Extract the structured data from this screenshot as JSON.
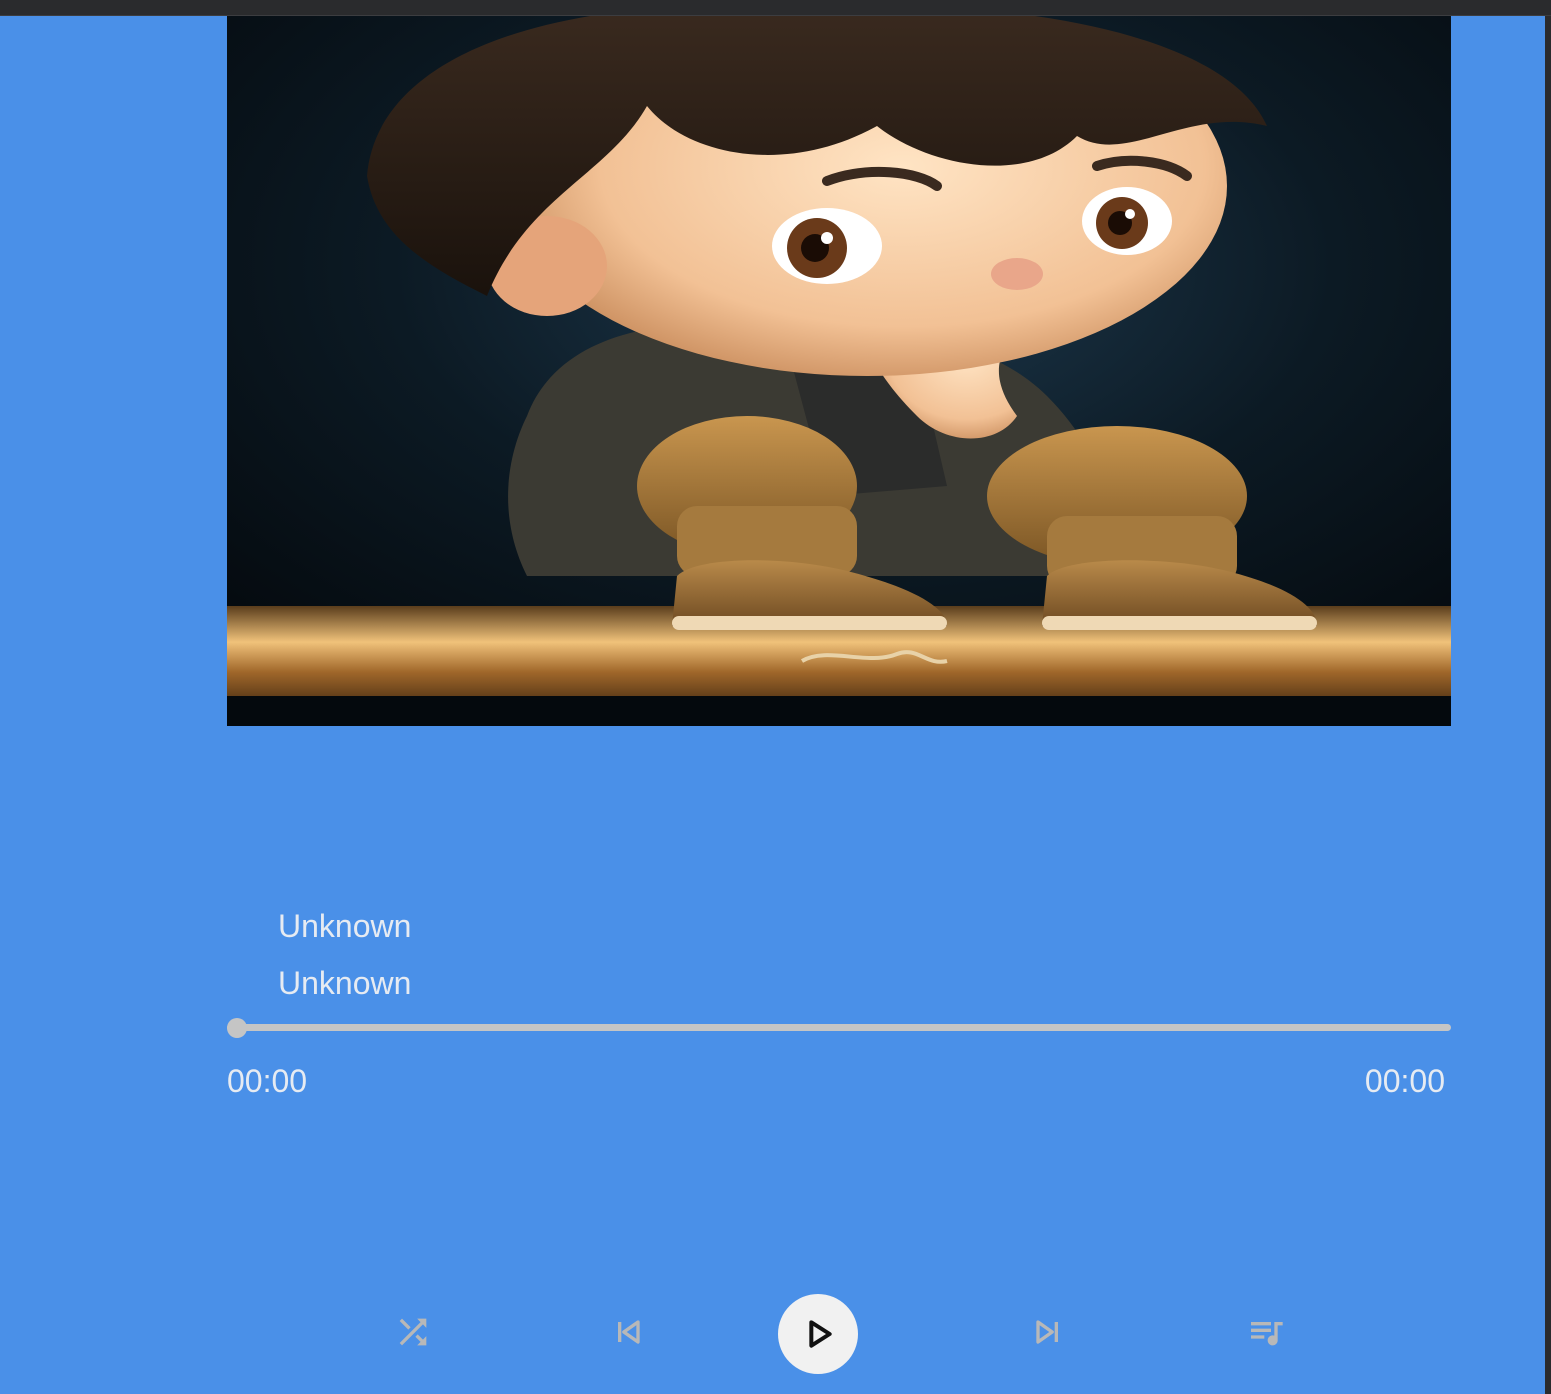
{
  "player": {
    "track": {
      "title": "Unknown",
      "artist": "Unknown"
    },
    "progress": {
      "current_time": "00:00",
      "total_time": "00:00",
      "fraction": 0
    },
    "controls": {
      "shuffle": "shuffle-icon",
      "previous": "skip-previous-icon",
      "play": "play-icon",
      "next": "skip-next-icon",
      "queue": "queue-music-icon"
    },
    "colors": {
      "background": "#4a90e8",
      "text": "#e6ebf2",
      "slider": "#c5c5c5",
      "icon": "#b8b8b8",
      "play_button": "#f1f1f1"
    }
  }
}
